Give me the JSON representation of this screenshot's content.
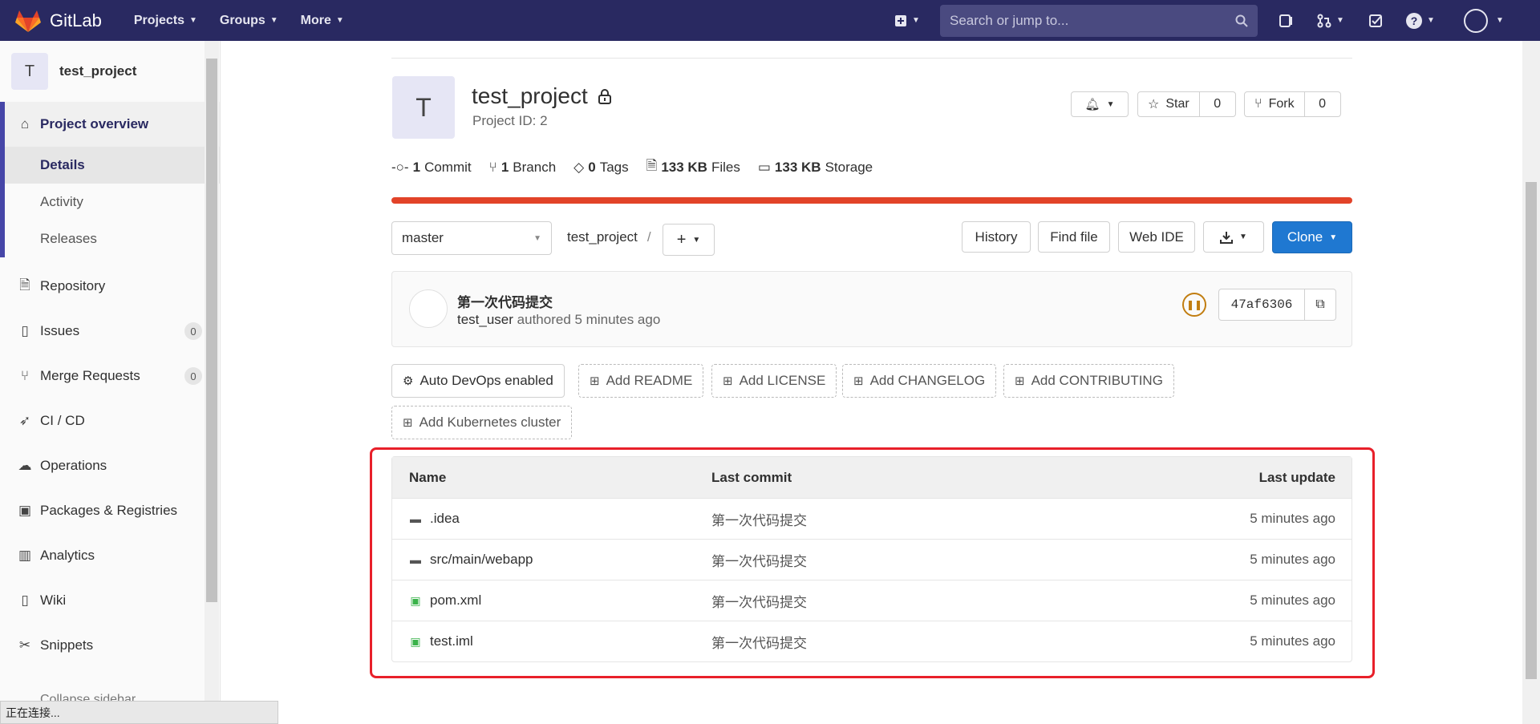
{
  "nav": {
    "brand": "GitLab",
    "items": [
      {
        "label": "Projects"
      },
      {
        "label": "Groups"
      },
      {
        "label": "More"
      }
    ],
    "search_placeholder": "Search or jump to..."
  },
  "sidebar": {
    "avatar_letter": "T",
    "project_name": "test_project",
    "overview_label": "Project overview",
    "sub_items": [
      "Details",
      "Activity",
      "Releases"
    ],
    "items": [
      {
        "label": "Repository",
        "icon": "document-icon"
      },
      {
        "label": "Issues",
        "icon": "issues-icon",
        "count": "0"
      },
      {
        "label": "Merge Requests",
        "icon": "merge-request-icon",
        "count": "0"
      },
      {
        "label": "CI / CD",
        "icon": "rocket-icon"
      },
      {
        "label": "Operations",
        "icon": "cloud-icon"
      },
      {
        "label": "Packages & Registries",
        "icon": "package-icon"
      },
      {
        "label": "Analytics",
        "icon": "chart-icon"
      },
      {
        "label": "Wiki",
        "icon": "book-icon"
      },
      {
        "label": "Snippets",
        "icon": "scissors-icon"
      }
    ],
    "collapse_label": "Collapse sidebar"
  },
  "status_bar": "正在连接...",
  "project": {
    "avatar_letter": "T",
    "title": "test_project",
    "id_text": "Project ID: 2",
    "star_label": "Star",
    "star_count": "0",
    "fork_label": "Fork",
    "fork_count": "0"
  },
  "stats": [
    {
      "value": "1",
      "label": "Commit"
    },
    {
      "value": "1",
      "label": "Branch"
    },
    {
      "value": "0",
      "label": "Tags"
    },
    {
      "value": "133 KB",
      "label": "Files"
    },
    {
      "value": "133 KB",
      "label": "Storage"
    }
  ],
  "toolbar": {
    "branch": "master",
    "path": "test_project",
    "path_sep": "/",
    "history": "History",
    "find_file": "Find file",
    "web_ide": "Web IDE",
    "clone": "Clone"
  },
  "commit": {
    "title": "第一次代码提交",
    "author": "test_user",
    "meta": "authored 5 minutes ago",
    "sha": "47af6306"
  },
  "actions": {
    "auto_devops": "Auto DevOps enabled",
    "readme": "Add README",
    "license": "Add LICENSE",
    "changelog": "Add CHANGELOG",
    "contributing": "Add CONTRIBUTING",
    "kubernetes": "Add Kubernetes cluster"
  },
  "files": {
    "headers": {
      "name": "Name",
      "last_commit": "Last commit",
      "last_update": "Last update"
    },
    "rows": [
      {
        "name": ".idea",
        "type": "folder",
        "commit": "第一次代码提交",
        "updated": "5 minutes ago"
      },
      {
        "name": "src/main/webapp",
        "type": "folder",
        "commit": "第一次代码提交",
        "updated": "5 minutes ago"
      },
      {
        "name": "pom.xml",
        "type": "file",
        "commit": "第一次代码提交",
        "updated": "5 minutes ago"
      },
      {
        "name": "test.iml",
        "type": "file",
        "commit": "第一次代码提交",
        "updated": "5 minutes ago"
      }
    ]
  },
  "colors": {
    "nav_bg": "#292961",
    "accent_orange": "#e24329",
    "primary_blue": "#1f78d1",
    "highlight_red": "#e8202a"
  }
}
